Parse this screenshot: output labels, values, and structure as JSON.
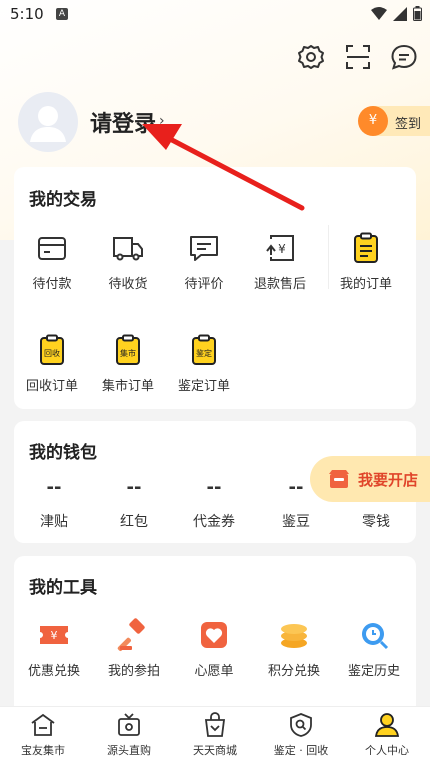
{
  "status_bar": {
    "time": "5:10",
    "app_badge": "A"
  },
  "profile": {
    "login_label": "请登录",
    "chevron": "›",
    "signin_label": "签到",
    "signin_icon_text": "¥"
  },
  "transactions": {
    "title": "我的交易",
    "items": [
      {
        "label": "待付款",
        "icon": "wallet-card-icon"
      },
      {
        "label": "待收货",
        "icon": "truck-icon"
      },
      {
        "label": "待评价",
        "icon": "comment-icon"
      },
      {
        "label": "退款售后",
        "icon": "refund-icon"
      },
      {
        "label": "我的订单",
        "icon": "order-list-icon"
      },
      {
        "label": "回收订单",
        "icon": "recycle-order-icon",
        "icon_text": "回收"
      },
      {
        "label": "集市订单",
        "icon": "market-order-icon",
        "icon_text": "集市"
      },
      {
        "label": "鉴定订单",
        "icon": "appraisal-order-icon",
        "icon_text": "鉴定"
      }
    ]
  },
  "wallet": {
    "title": "我的钱包",
    "items": [
      {
        "label": "津贴",
        "value": "--"
      },
      {
        "label": "红包",
        "value": "--"
      },
      {
        "label": "代金券",
        "value": "--"
      },
      {
        "label": "鉴豆",
        "value": "--"
      },
      {
        "label": "零钱",
        "value": ""
      }
    ]
  },
  "open_store": {
    "label": "我要开店"
  },
  "tools": {
    "title": "我的工具",
    "items": [
      {
        "label": "优惠兑换",
        "icon": "coupon-ticket-icon"
      },
      {
        "label": "我的参拍",
        "icon": "auction-hammer-icon"
      },
      {
        "label": "心愿单",
        "icon": "heart-wishlist-icon"
      },
      {
        "label": "积分兑换",
        "icon": "coin-stack-icon"
      },
      {
        "label": "鉴定历史",
        "icon": "history-search-icon"
      }
    ]
  },
  "bottom_nav": [
    {
      "label": "宝友集市",
      "icon": "house-icon"
    },
    {
      "label": "源头直购",
      "icon": "tv-shop-icon"
    },
    {
      "label": "天天商城",
      "icon": "shopping-bag-icon"
    },
    {
      "label": "鉴定 · 回收",
      "icon": "shield-search-icon"
    },
    {
      "label": "个人中心",
      "icon": "person-icon"
    }
  ],
  "colors": {
    "accent_yellow": "#ffd21f",
    "accent_red": "#e0452a",
    "arrow_red": "#e8201c"
  }
}
